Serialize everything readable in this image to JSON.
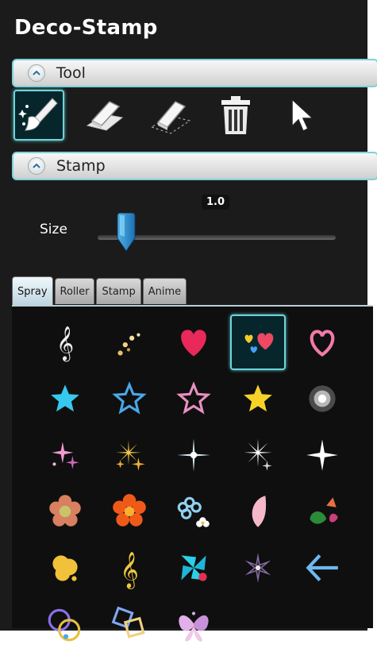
{
  "app": {
    "title": "Deco-Stamp"
  },
  "sections": {
    "tool": "Tool",
    "stamp": "Stamp"
  },
  "tools": [
    {
      "name": "deco-brush-tool",
      "selected": true
    },
    {
      "name": "eraser-tool",
      "selected": false
    },
    {
      "name": "selection-eraser-tool",
      "selected": false
    },
    {
      "name": "trash-tool",
      "selected": false
    },
    {
      "name": "pointer-tool",
      "selected": false
    }
  ],
  "size": {
    "label": "Size",
    "value": "1.0",
    "level": 0.12
  },
  "tabs": [
    {
      "label": "Spray",
      "active": true
    },
    {
      "label": "Roller",
      "active": false
    },
    {
      "label": "Stamp",
      "active": false
    },
    {
      "label": "Anime",
      "active": false
    }
  ],
  "stamps": [
    "treble-clef-icon",
    "sparkle-trail-icon",
    "heart-icon",
    "hearts-icon",
    "heart-outline-icon",
    "cyan-star-icon",
    "blue-star-outline-icon",
    "pink-star-outline-icon",
    "gold-star-icon",
    "glow-icon",
    "pink-sparkles-icon",
    "gold-sparkles-icon",
    "twinkle-icon",
    "white-twinkle-icon",
    "four-point-star-icon",
    "pink-flower-icon",
    "orange-flower-icon",
    "blue-flowers-icon",
    "petal-icon",
    "leaves-icon",
    "yellow-blob-icon",
    "music-note-icon",
    "pinwheel-icon",
    "burst-icon",
    "arrow-left-icon",
    "circles-icon",
    "squares-icon",
    "butterfly-icon"
  ],
  "selected_stamp": 3,
  "colors": {
    "accent": "#6ed4d8",
    "panel": "#1b1b1b"
  }
}
